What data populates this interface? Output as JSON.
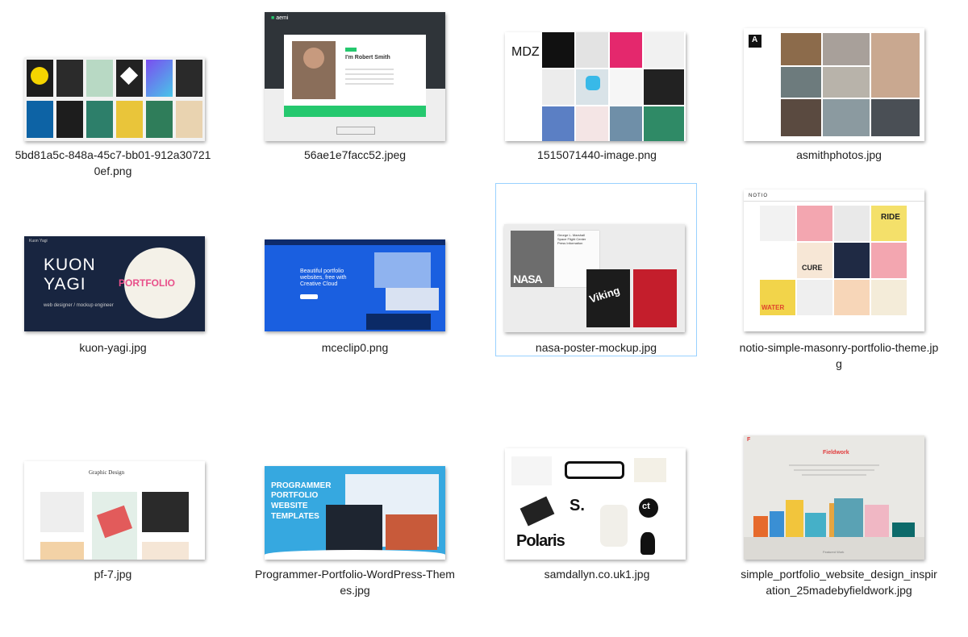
{
  "files": [
    {
      "name": "5bd81a5c-848a-45c7-bb01-912a307210ef.png"
    },
    {
      "name": "56ae1e7facc52.jpeg",
      "preview": {
        "brand": "aemi",
        "badge": "HELLO",
        "heading": "I'm Robert Smith",
        "subheading": "Developer and Local Kreator",
        "download_label": "DOWNLOAD RESUME"
      }
    },
    {
      "name": "1515071440-image.png",
      "preview": {
        "logo": "MDZ"
      }
    },
    {
      "name": "asmithphotos.jpg",
      "preview": {
        "logo": "A"
      }
    },
    {
      "name": "kuon-yagi.jpg",
      "preview": {
        "title_line1": "KUON",
        "title_line2": "YAGI",
        "portfolio": "PORTFOLIO",
        "role": "web designer / mockup engineer",
        "header_name": "Kuon Yagi"
      }
    },
    {
      "name": "mceclip0.png",
      "preview": {
        "tagline": "Beautiful portfolio websites, free with Creative Cloud"
      }
    },
    {
      "name": "nasa-poster-mockup.jpg",
      "selected": true,
      "preview": {
        "nasa": "NASA",
        "viking": "Viking",
        "card_text": "George L. Marshall Space Flight Center Press Information"
      }
    },
    {
      "name": "notio-simple-masonry-portfolio-theme.jpg",
      "preview": {
        "logo": "NOTIO",
        "ride": "RIDE",
        "cure": "CURE",
        "water": "WATER"
      }
    },
    {
      "name": "pf-7.jpg",
      "preview": {
        "title": "Graphic Design"
      }
    },
    {
      "name": "Programmer-Portfolio-WordPress-Themes.jpg",
      "preview": {
        "line1": "PROGRAMMER",
        "line2": "PORTFOLIO",
        "line3": "WEBSITE",
        "line4": "TEMPLATES"
      }
    },
    {
      "name": "samdallyn.co.uk1.jpg",
      "preview": {
        "s_logo": "S.",
        "ct_logo": "ct",
        "polaris": "Polaris"
      }
    },
    {
      "name": "simple_portfolio_website_design_inspiration_25madebyfieldwork.jpg",
      "preview": {
        "title": "Fieldwork",
        "footer": "Featured Work"
      }
    }
  ]
}
